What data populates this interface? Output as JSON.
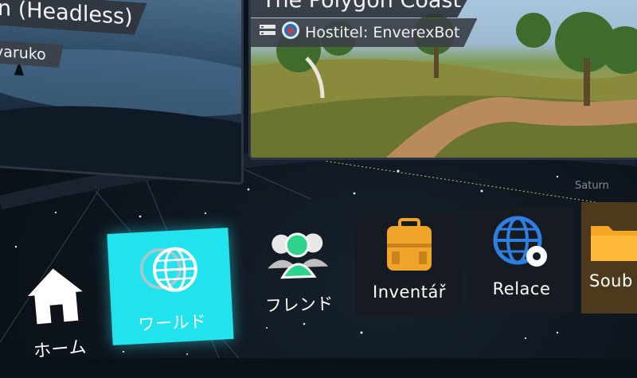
{
  "worlds": [
    {
      "title": "n (Headless)",
      "host": "varuko"
    },
    {
      "title": "The Polygon Coast",
      "host": "Hostitel: EnverexBot"
    }
  ],
  "menu": {
    "items": [
      {
        "label": "ホーム",
        "icon": "home-icon",
        "active": false
      },
      {
        "label": "ワールド",
        "icon": "globe-icon",
        "active": true
      },
      {
        "label": "フレンド",
        "icon": "friends-icon",
        "active": false
      },
      {
        "label": "Inventář",
        "icon": "backpack-icon",
        "active": false
      },
      {
        "label": "Relace",
        "icon": "globe-gear-icon",
        "active": false
      },
      {
        "label": "Soub",
        "icon": "folder-icon",
        "active": false
      }
    ],
    "hint": "Saturn"
  },
  "colors": {
    "accent": "#21e3ee",
    "inventory": "#f0a52a",
    "sessions": "#2f7fe0",
    "friends": "#2dd38a"
  }
}
